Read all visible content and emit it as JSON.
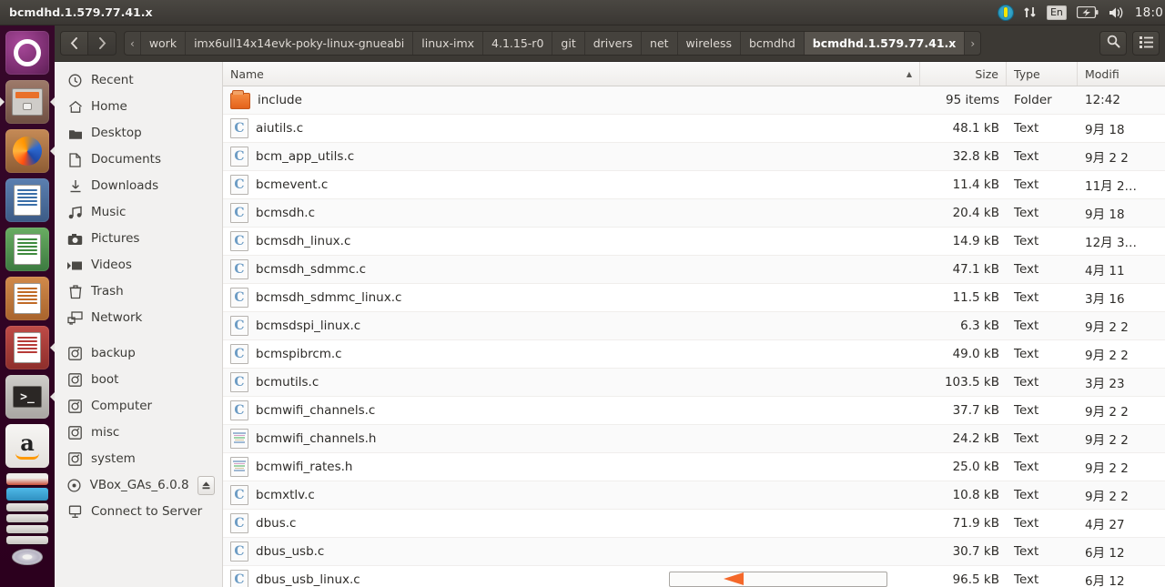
{
  "panel": {
    "title": "bcmdhd.1.579.77.41.x",
    "indicators": {
      "sync_icon": "up-down-arrows-icon",
      "keyboard_layout": "En",
      "battery_icon": "battery-icon",
      "volume_icon": "volume-icon",
      "ubuntu_icon": "ubuntu-indicator-icon"
    },
    "clock": "18:0"
  },
  "launcher": {
    "items": [
      {
        "name": "ubuntu-dash",
        "icon": "ubuntu-logo-icon"
      },
      {
        "name": "files",
        "icon": "file-manager-icon"
      },
      {
        "name": "firefox",
        "icon": "firefox-icon"
      },
      {
        "name": "libreoffice-writer",
        "icon": "writer-icon"
      },
      {
        "name": "libreoffice-calc",
        "icon": "calc-icon"
      },
      {
        "name": "libreoffice-impress",
        "icon": "impress-icon"
      },
      {
        "name": "document-viewer",
        "icon": "pdf-icon"
      },
      {
        "name": "terminal",
        "icon": "terminal-icon"
      },
      {
        "name": "amazon",
        "icon": "amazon-icon"
      }
    ]
  },
  "toolbar": {
    "back_icon": "chevron-left-icon",
    "forward_icon": "chevron-right-icon",
    "overflow_prev": "‹",
    "overflow_next": "›",
    "search_icon": "search-icon",
    "view_icon": "list-view-icon",
    "breadcrumbs": [
      {
        "label": "work",
        "active": false
      },
      {
        "label": "imx6ull14x14evk-poky-linux-gnueabi",
        "active": false
      },
      {
        "label": "linux-imx",
        "active": false
      },
      {
        "label": "4.1.15-r0",
        "active": false
      },
      {
        "label": "git",
        "active": false
      },
      {
        "label": "drivers",
        "active": false
      },
      {
        "label": "net",
        "active": false
      },
      {
        "label": "wireless",
        "active": false
      },
      {
        "label": "bcmdhd",
        "active": false
      },
      {
        "label": "bcmdhd.1.579.77.41.x",
        "active": true
      }
    ]
  },
  "sidebar": {
    "places": [
      {
        "label": "Recent",
        "icon": "clock-icon"
      },
      {
        "label": "Home",
        "icon": "home-icon"
      },
      {
        "label": "Desktop",
        "icon": "desktop-folder-icon"
      },
      {
        "label": "Documents",
        "icon": "document-icon"
      },
      {
        "label": "Downloads",
        "icon": "download-icon"
      },
      {
        "label": "Music",
        "icon": "music-icon"
      },
      {
        "label": "Pictures",
        "icon": "camera-icon"
      },
      {
        "label": "Videos",
        "icon": "video-icon"
      },
      {
        "label": "Trash",
        "icon": "trash-icon"
      },
      {
        "label": "Network",
        "icon": "network-icon"
      }
    ],
    "devices": [
      {
        "label": "backup",
        "icon": "drive-icon",
        "eject": false
      },
      {
        "label": "boot",
        "icon": "drive-icon",
        "eject": false
      },
      {
        "label": "Computer",
        "icon": "drive-icon",
        "eject": false
      },
      {
        "label": "misc",
        "icon": "drive-icon",
        "eject": false
      },
      {
        "label": "system",
        "icon": "drive-icon",
        "eject": false
      },
      {
        "label": "VBox_GAs_6.0.8",
        "icon": "disc-icon",
        "eject": true
      },
      {
        "label": "Connect to Server",
        "icon": "server-icon",
        "eject": false
      }
    ],
    "eject_icon": "eject-icon"
  },
  "file_list": {
    "columns": [
      {
        "key": "name",
        "label": "Name",
        "sorted": "asc",
        "sort_glyph": "▲"
      },
      {
        "key": "size",
        "label": "Size"
      },
      {
        "key": "type",
        "label": "Type"
      },
      {
        "key": "modified",
        "label": "Modifi"
      }
    ],
    "rows": [
      {
        "name": "include",
        "size": "95 items",
        "type": "Folder",
        "modified": "12:42",
        "icon": "folder"
      },
      {
        "name": "aiutils.c",
        "size": "48.1 kB",
        "type": "Text",
        "modified": "9月 18",
        "icon": "cfile"
      },
      {
        "name": "bcm_app_utils.c",
        "size": "32.8 kB",
        "type": "Text",
        "modified": "9月 2 2",
        "icon": "cfile"
      },
      {
        "name": "bcmevent.c",
        "size": "11.4 kB",
        "type": "Text",
        "modified": "11月 2…",
        "icon": "cfile"
      },
      {
        "name": "bcmsdh.c",
        "size": "20.4 kB",
        "type": "Text",
        "modified": "9月 18",
        "icon": "cfile"
      },
      {
        "name": "bcmsdh_linux.c",
        "size": "14.9 kB",
        "type": "Text",
        "modified": "12月 3…",
        "icon": "cfile"
      },
      {
        "name": "bcmsdh_sdmmc.c",
        "size": "47.1 kB",
        "type": "Text",
        "modified": "4月 11",
        "icon": "cfile"
      },
      {
        "name": "bcmsdh_sdmmc_linux.c",
        "size": "11.5 kB",
        "type": "Text",
        "modified": "3月 16",
        "icon": "cfile"
      },
      {
        "name": "bcmsdspi_linux.c",
        "size": "6.3 kB",
        "type": "Text",
        "modified": "9月 2 2",
        "icon": "cfile"
      },
      {
        "name": "bcmspibrcm.c",
        "size": "49.0 kB",
        "type": "Text",
        "modified": "9月 2 2",
        "icon": "cfile"
      },
      {
        "name": "bcmutils.c",
        "size": "103.5 kB",
        "type": "Text",
        "modified": "3月 23",
        "icon": "cfile"
      },
      {
        "name": "bcmwifi_channels.c",
        "size": "37.7 kB",
        "type": "Text",
        "modified": "9月 2 2",
        "icon": "cfile"
      },
      {
        "name": "bcmwifi_channels.h",
        "size": "24.2 kB",
        "type": "Text",
        "modified": "9月 2 2",
        "icon": "hfile"
      },
      {
        "name": "bcmwifi_rates.h",
        "size": "25.0 kB",
        "type": "Text",
        "modified": "9月 2 2",
        "icon": "hfile"
      },
      {
        "name": "bcmxtlv.c",
        "size": "10.8 kB",
        "type": "Text",
        "modified": "9月 2 2",
        "icon": "cfile"
      },
      {
        "name": "dbus.c",
        "size": "71.9 kB",
        "type": "Text",
        "modified": "4月 27",
        "icon": "cfile"
      },
      {
        "name": "dbus_usb.c",
        "size": "30.7 kB",
        "type": "Text",
        "modified": "6月 12",
        "icon": "cfile"
      },
      {
        "name": "dbus_usb_linux.c",
        "size": "96.5 kB",
        "type": "Text",
        "modified": "6月 12",
        "icon": "cfile"
      }
    ]
  },
  "annotation": {
    "arrow_color": "#f4682a"
  },
  "colors": {
    "launcher_bg": "#2c001e",
    "panel_bg": "#3a3733",
    "toolbar_bg": "#3c3934",
    "sidebar_bg": "#f2f1f0",
    "accent_orange": "#e4621c"
  }
}
